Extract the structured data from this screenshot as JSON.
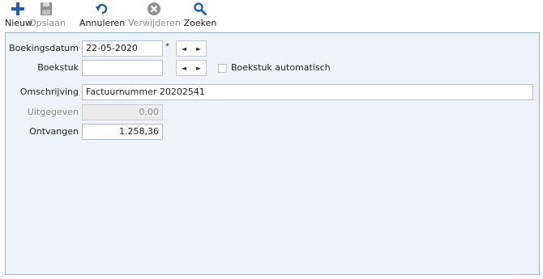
{
  "toolbar": {
    "new_label": "Nieuw",
    "save_label": "Opslaan",
    "cancel_label": "Annuleren",
    "delete_label": "Verwijderen",
    "search_label": "Zoeken"
  },
  "colors": {
    "accent": "#1e5fb4",
    "disabled": "#8c8c8c",
    "panel_bg": "#eef3f9",
    "panel_border": "#9cb0c8"
  },
  "icons": {
    "new": "plus-icon",
    "save": "floppy-disk-icon",
    "cancel": "undo-icon",
    "delete": "circle-x-icon",
    "search": "magnifier-icon"
  },
  "form": {
    "boekingsdatum": {
      "label": "Boekingsdatum",
      "value": "22-05-2020",
      "required_marker": "*"
    },
    "boekstuk": {
      "label": "Boekstuk",
      "value": ""
    },
    "boekstuk_auto": {
      "label": "Boekstuk automatisch",
      "checked": false
    },
    "omschrijving": {
      "label": "Omschrijving",
      "value": "Factuurnummer 20202541"
    },
    "uitgegeven": {
      "label": "Uitgegeven",
      "value": "0,00"
    },
    "ontvangen": {
      "label": "Ontvangen",
      "value": "1.258,36"
    },
    "nav": {
      "prev": "◄",
      "next": "►"
    }
  }
}
